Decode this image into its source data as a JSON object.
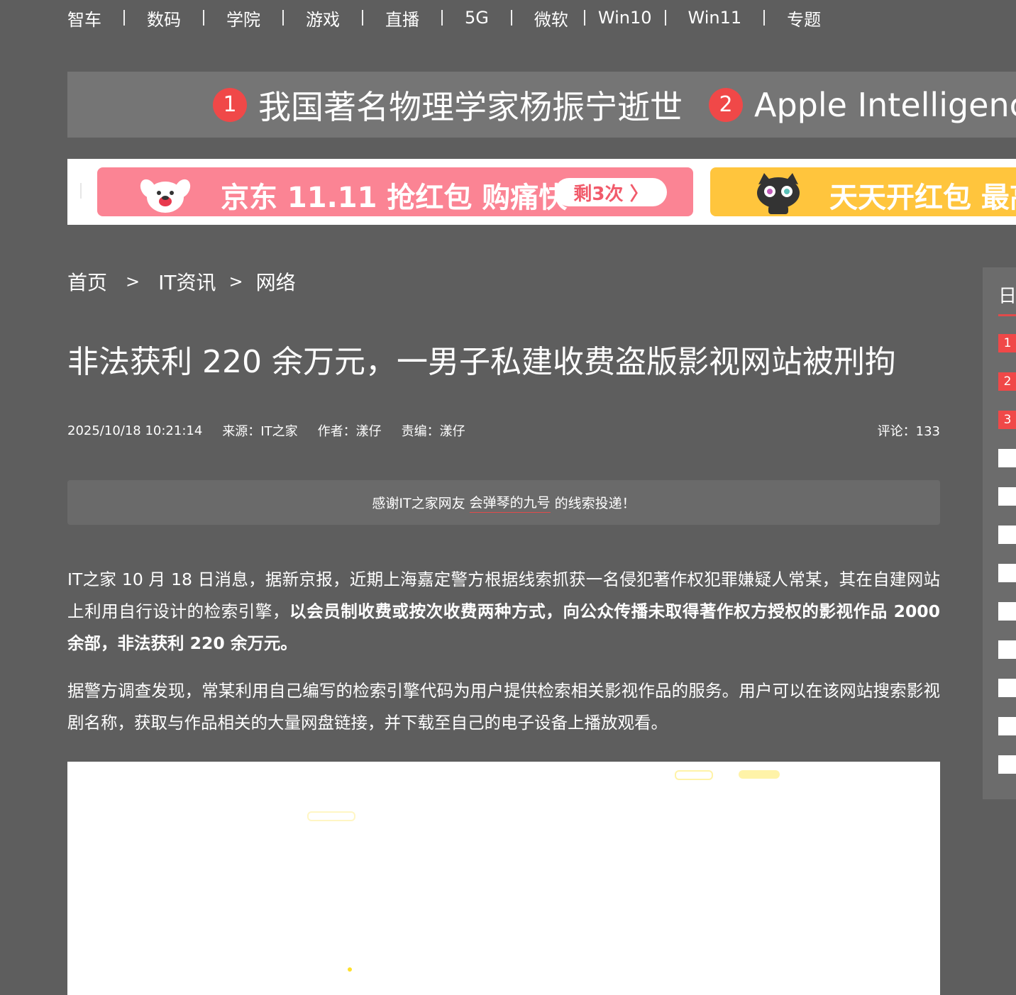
{
  "nav": {
    "items": [
      "智车",
      "数码",
      "学院",
      "游戏",
      "直播",
      "5G",
      "微软",
      "Win10",
      "Win11",
      "专题"
    ]
  },
  "hot": {
    "items": [
      {
        "num": "1",
        "text": "我国著名物理学家杨振宁逝世"
      },
      {
        "num": "2",
        "text": "Apple Intelligence"
      }
    ]
  },
  "promo": {
    "jd_text": "京东 11.11 抢红包 购痛快",
    "jd_pill": "剩3次 〉",
    "tm_text": "天天开红包 最高"
  },
  "breadcrumb": {
    "home": "首页",
    "sep": ">",
    "category": "IT资讯",
    "sub": "网络"
  },
  "article": {
    "title": "非法获利 220 余万元，一男子私建收费盗版影视网站被刑拘",
    "date": "2025/10/18 10:21:14",
    "source": "来源：IT之家",
    "author": "作者：漾仔",
    "editor": "责编：漾仔",
    "comments": "评论：133",
    "thanks_pre": "感谢IT之家网友",
    "thanks_user": "会弹琴的九号",
    "thanks_post": "的线索投递！",
    "p1_normal": "IT之家 10 月 18 日消息，据新京报，近期上海嘉定警方根据线索抓获一名侵犯著作权犯罪嫌疑人常某，其在自建网站上利用自行设计的检索引擎，",
    "p1_bold": "以会员制收费或按次收费两种方式，向公众传播未取得著作权方授权的影视作品 2000 余部，非法获利 220 余万元。",
    "p2": "据警方调查发现，常某利用自己编写的检索引擎代码为用户提供检索相关影视作品的服务。用户可以在该网站搜索影视剧名称，获取与作品相关的大量网盘链接，并下载至自己的电子设备上播放观看。"
  },
  "sidebar": {
    "head": "日",
    "ranks": [
      "1",
      "2",
      "3"
    ]
  },
  "colors": {
    "page_bg": "#5e5e5e",
    "accent_red": "#f04848",
    "jd_pink": "#fb8494",
    "tmall_yellow": "#ffc53d"
  }
}
